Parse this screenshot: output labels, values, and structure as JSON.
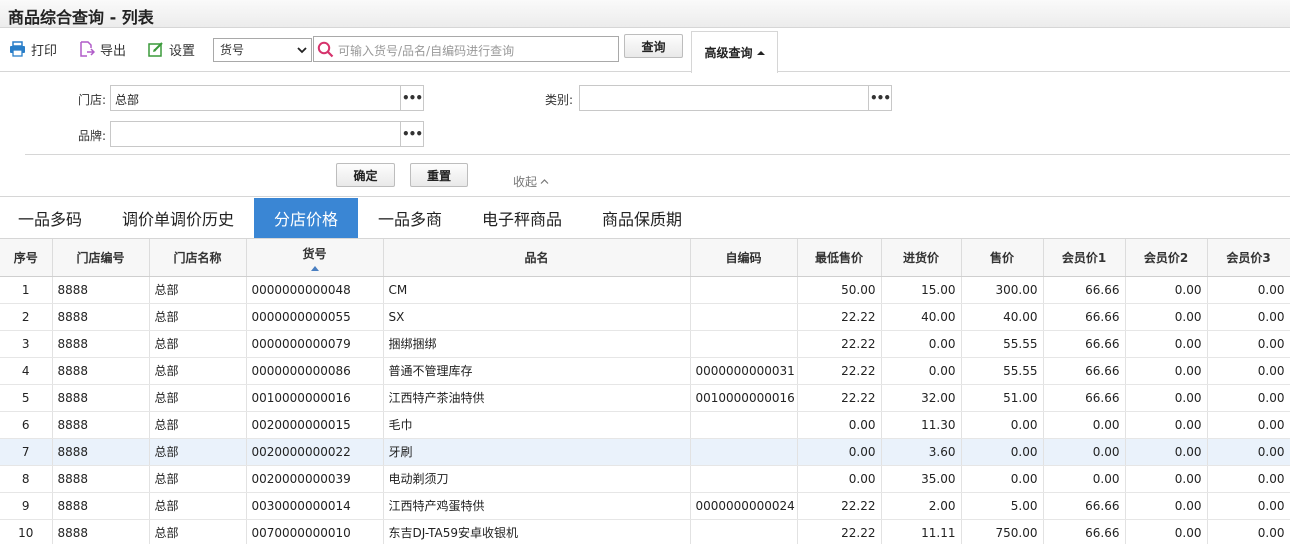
{
  "window": {
    "title": "商品综合查询 - 列表"
  },
  "toolbar": {
    "print_label": "打印",
    "export_label": "导出",
    "settings_label": "设置",
    "search_field_selected": "货号",
    "search_placeholder": "可输入货号/品名/自编码进行查询",
    "query_label": "查询",
    "advanced_label": "高级查询"
  },
  "filters": {
    "store_label": "门店:",
    "store_value": "总部",
    "category_label": "类别:",
    "category_value": "",
    "brand_label": "品牌:",
    "brand_value": "",
    "more_glyph": "•••",
    "confirm_label": "确定",
    "reset_label": "重置",
    "collapse_label": "收起"
  },
  "tabs": [
    "一品多码",
    "调价单调价历史",
    "分店价格",
    "一品多商",
    "电子秤商品",
    "商品保质期"
  ],
  "active_tab": 2,
  "table": {
    "headers": [
      "序号",
      "门店编号",
      "门店名称",
      "货号",
      "品名",
      "自编码",
      "最低售价",
      "进货价",
      "售价",
      "会员价1",
      "会员价2",
      "会员价3"
    ],
    "sorted_column": 3,
    "highlighted_row": 6,
    "rows": [
      [
        "1",
        "8888",
        "总部",
        "0000000000048",
        "CM",
        "",
        "50.00",
        "15.00",
        "300.00",
        "66.66",
        "0.00",
        "0.00"
      ],
      [
        "2",
        "8888",
        "总部",
        "0000000000055",
        "SX",
        "",
        "22.22",
        "40.00",
        "40.00",
        "66.66",
        "0.00",
        "0.00"
      ],
      [
        "3",
        "8888",
        "总部",
        "0000000000079",
        "捆绑捆绑",
        "",
        "22.22",
        "0.00",
        "55.55",
        "66.66",
        "0.00",
        "0.00"
      ],
      [
        "4",
        "8888",
        "总部",
        "0000000000086",
        "普通不管理库存",
        "0000000000031",
        "22.22",
        "0.00",
        "55.55",
        "66.66",
        "0.00",
        "0.00"
      ],
      [
        "5",
        "8888",
        "总部",
        "0010000000016",
        "江西特产茶油特供",
        "0010000000016",
        "22.22",
        "32.00",
        "51.00",
        "66.66",
        "0.00",
        "0.00"
      ],
      [
        "6",
        "8888",
        "总部",
        "0020000000015",
        "毛巾",
        "",
        "0.00",
        "11.30",
        "0.00",
        "0.00",
        "0.00",
        "0.00"
      ],
      [
        "7",
        "8888",
        "总部",
        "0020000000022",
        "牙刷",
        "",
        "0.00",
        "3.60",
        "0.00",
        "0.00",
        "0.00",
        "0.00"
      ],
      [
        "8",
        "8888",
        "总部",
        "0020000000039",
        "电动剃须刀",
        "",
        "0.00",
        "35.00",
        "0.00",
        "0.00",
        "0.00",
        "0.00"
      ],
      [
        "9",
        "8888",
        "总部",
        "0030000000014",
        "江西特产鸡蛋特供",
        "0000000000024",
        "22.22",
        "2.00",
        "5.00",
        "66.66",
        "0.00",
        "0.00"
      ],
      [
        "10",
        "8888",
        "总部",
        "0070000000010",
        "东吉DJ-TA59安卓收银机",
        "",
        "22.22",
        "11.11",
        "750.00",
        "66.66",
        "0.00",
        "0.00"
      ]
    ]
  },
  "colors": {
    "accent": "#3a86d4",
    "row_highlight": "#eaf2fb",
    "print_icon": "#2a7fc9",
    "export_icon": "#b05cc9",
    "settings_icon": "#3a9a3a"
  }
}
